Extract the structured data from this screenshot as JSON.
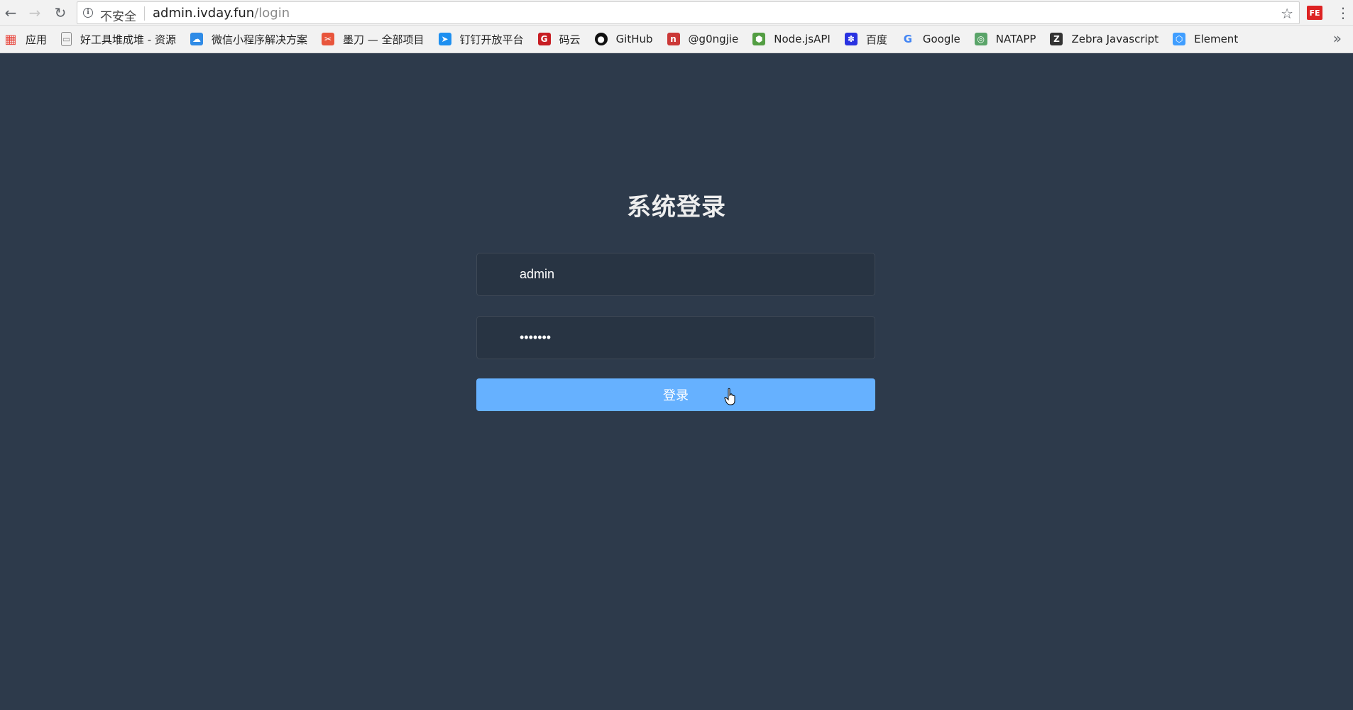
{
  "browser": {
    "security_label": "不安全",
    "url_host": "admin.ivday.fun",
    "url_path": "/login",
    "extension_label": "FE"
  },
  "bookmarks": [
    {
      "label": "应用",
      "icon": "apps-grid-icon",
      "color": "#e8453c"
    },
    {
      "label": "好工具堆成堆 - 资源",
      "icon": "page-icon",
      "color": "#888888"
    },
    {
      "label": "微信小程序解决方案",
      "icon": "cloud-icon",
      "color": "#2f8be6"
    },
    {
      "label": "墨刀 — 全部项目",
      "icon": "modao-icon",
      "color": "#e8553c"
    },
    {
      "label": "钉钉开放平台",
      "icon": "dingtalk-icon",
      "color": "#1d8ff0"
    },
    {
      "label": "码云",
      "icon": "gitee-icon",
      "color": "#c71d23"
    },
    {
      "label": "GitHub",
      "icon": "github-icon",
      "color": "#111111"
    },
    {
      "label": "@g0ngjie",
      "icon": "npm-icon",
      "color": "#cb3837"
    },
    {
      "label": "Node.jsAPI",
      "icon": "nodejs-icon",
      "color": "#539e43"
    },
    {
      "label": "百度",
      "icon": "baidu-paw-icon",
      "color": "#2932e1"
    },
    {
      "label": "Google",
      "icon": "google-icon",
      "color": "#4285f4"
    },
    {
      "label": "NATAPP",
      "icon": "natapp-icon",
      "color": "#5aa469"
    },
    {
      "label": "Zebra Javascript",
      "icon": "zebra-icon",
      "color": "#333333"
    },
    {
      "label": "Element",
      "icon": "element-icon",
      "color": "#409eff"
    }
  ],
  "login": {
    "title": "系统登录",
    "username_value": "admin",
    "password_value": "•••••••",
    "submit_label": "登录"
  },
  "colors": {
    "page_bg": "#2d3a4b",
    "button_bg": "#66b1ff",
    "title_text": "#eeeeee"
  }
}
